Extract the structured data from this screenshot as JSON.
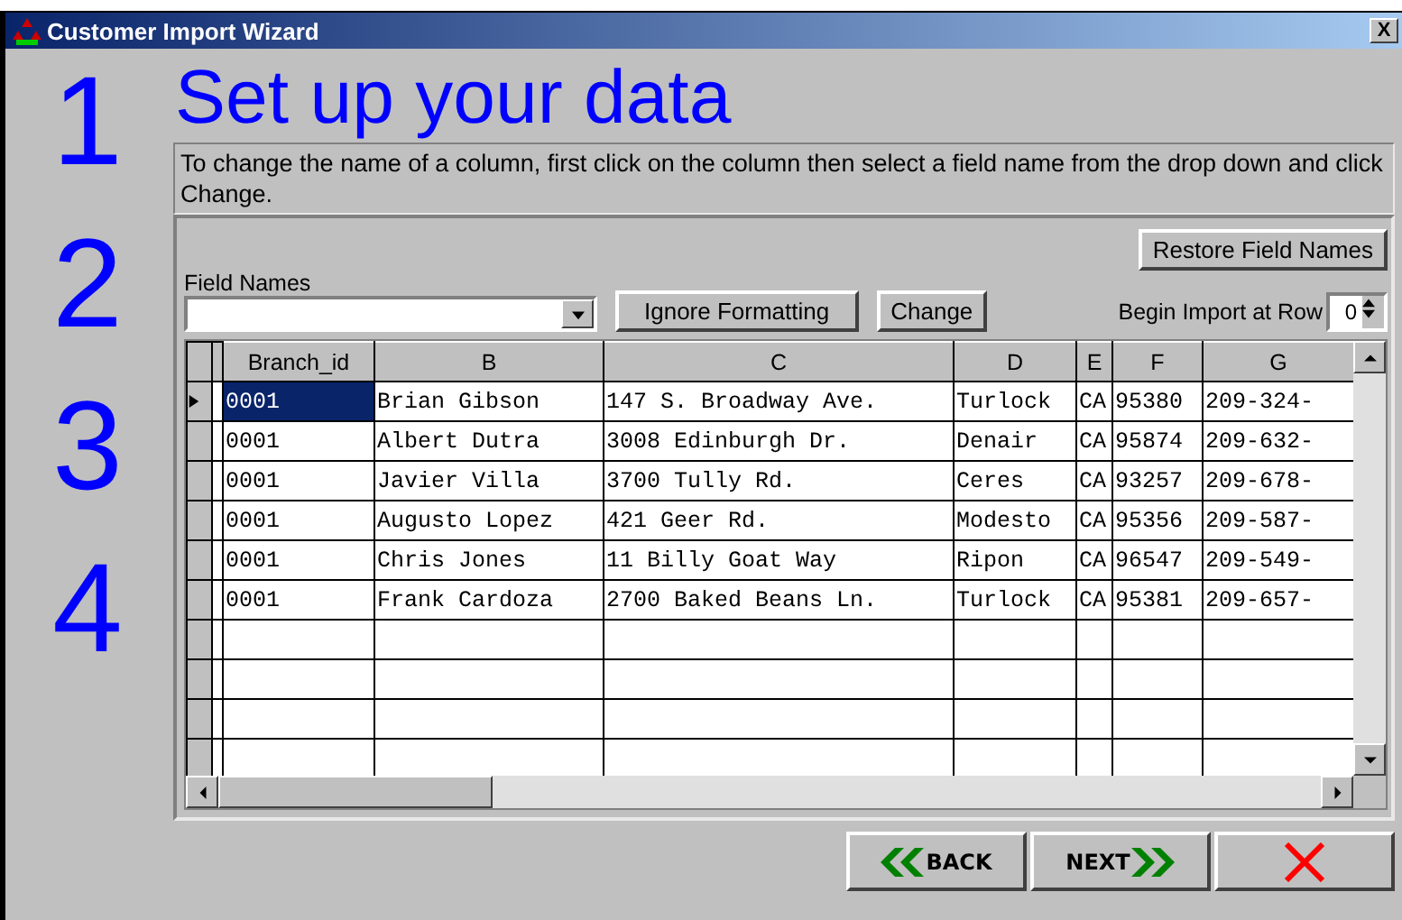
{
  "window": {
    "title": "Customer Import Wizard",
    "close": "X"
  },
  "steps": [
    "1",
    "2",
    "3",
    "4"
  ],
  "heading": "Set up your data",
  "instructions": "To change the name of a column, first click on the column then select a field name from the drop down and click Change.",
  "restore_button": "Restore Field Names",
  "field_names": {
    "label": "Field Names"
  },
  "ignore_button": "Ignore Formatting",
  "change_button": "Change",
  "begin_import": {
    "label": "Begin Import at Row",
    "value": "0"
  },
  "table": {
    "columns": [
      "Branch_id",
      "B",
      "C",
      "D",
      "E",
      "F",
      "G"
    ],
    "rows": [
      {
        "selected": true,
        "cells": [
          "0001",
          "Brian Gibson",
          "147 S. Broadway Ave.",
          "Turlock",
          "CA",
          "95380",
          "209-324-"
        ]
      },
      {
        "selected": false,
        "cells": [
          "0001",
          "Albert Dutra",
          "3008 Edinburgh Dr.",
          "Denair",
          "CA",
          "95874",
          "209-632-"
        ]
      },
      {
        "selected": false,
        "cells": [
          "0001",
          "Javier Villa",
          "3700 Tully Rd.",
          "Ceres",
          "CA",
          "93257",
          "209-678-"
        ]
      },
      {
        "selected": false,
        "cells": [
          "0001",
          "Augusto Lopez",
          "421 Geer Rd.",
          "Modesto",
          "CA",
          "95356",
          "209-587-"
        ]
      },
      {
        "selected": false,
        "cells": [
          "0001",
          "Chris Jones",
          "11 Billy Goat Way",
          "Ripon",
          "CA",
          "96547",
          "209-549-"
        ]
      },
      {
        "selected": false,
        "cells": [
          "0001",
          "Frank Cardoza",
          "2700 Baked Beans Ln.",
          "Turlock",
          "CA",
          "95381",
          "209-657-"
        ]
      }
    ]
  },
  "nav": {
    "back": "BACK",
    "next": "NEXT"
  }
}
